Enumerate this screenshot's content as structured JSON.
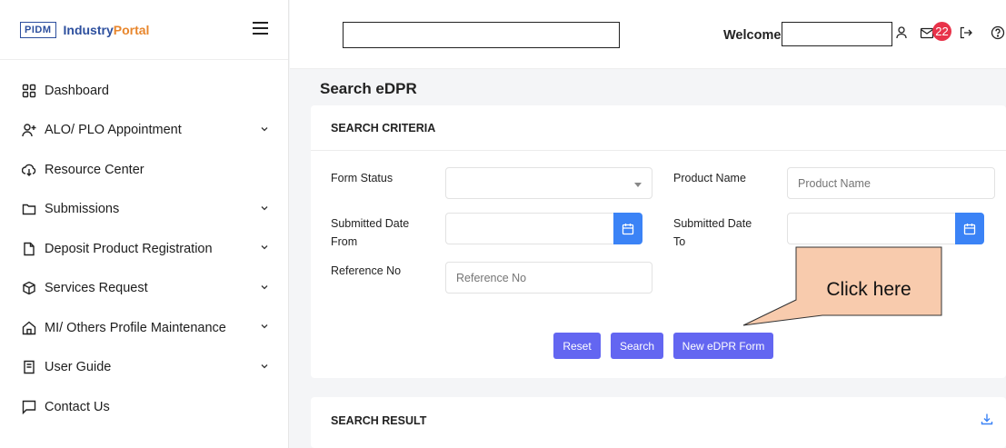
{
  "sidebar": {
    "logo": "PIDM",
    "brand_part1": "Industry",
    "brand_part2": "Portal",
    "items": [
      {
        "label": "Dashboard",
        "icon": "dashboard-grid-icon",
        "has_chevron": false
      },
      {
        "label": "ALO/ PLO Appointment",
        "icon": "add-user-icon",
        "has_chevron": true
      },
      {
        "label": "Resource Center",
        "icon": "cloud-download-icon",
        "has_chevron": false
      },
      {
        "label": "Submissions",
        "icon": "folder-icon",
        "has_chevron": true
      },
      {
        "label": "Deposit Product Registration",
        "icon": "file-icon",
        "has_chevron": true
      },
      {
        "label": "Services Request",
        "icon": "box-icon",
        "has_chevron": true
      },
      {
        "label": "MI/ Others Profile Maintenance",
        "icon": "home-icon",
        "has_chevron": true
      },
      {
        "label": "User Guide",
        "icon": "book-icon",
        "has_chevron": true
      },
      {
        "label": "Contact Us",
        "icon": "message-icon",
        "has_chevron": false
      }
    ]
  },
  "header": {
    "search_value": "",
    "welcome_label": "Welcome",
    "welcome_value": "",
    "notification_count": "22"
  },
  "main": {
    "page_title": "Search eDPR",
    "criteria_title": "SEARCH CRITERIA",
    "form_status_label": "Form Status",
    "form_status_value": "",
    "product_name_label": "Product Name",
    "product_name_placeholder": "Product Name",
    "submitted_from_label": "Submitted Date From",
    "submitted_to_label": "Submitted Date To",
    "reference_no_label": "Reference No",
    "reference_no_placeholder": "Reference No",
    "reset_label": "Reset",
    "search_label": "Search",
    "new_form_label": "New eDPR Form",
    "result_title": "SEARCH RESULT"
  },
  "callout": {
    "text": "Click here"
  },
  "colors": {
    "brand_blue": "#2d4f9e",
    "brand_orange": "#e8862c",
    "button": "#6366f1",
    "calendar_button": "#3b83f6",
    "badge": "#e8334a",
    "callout_fill": "#f8cbad"
  }
}
